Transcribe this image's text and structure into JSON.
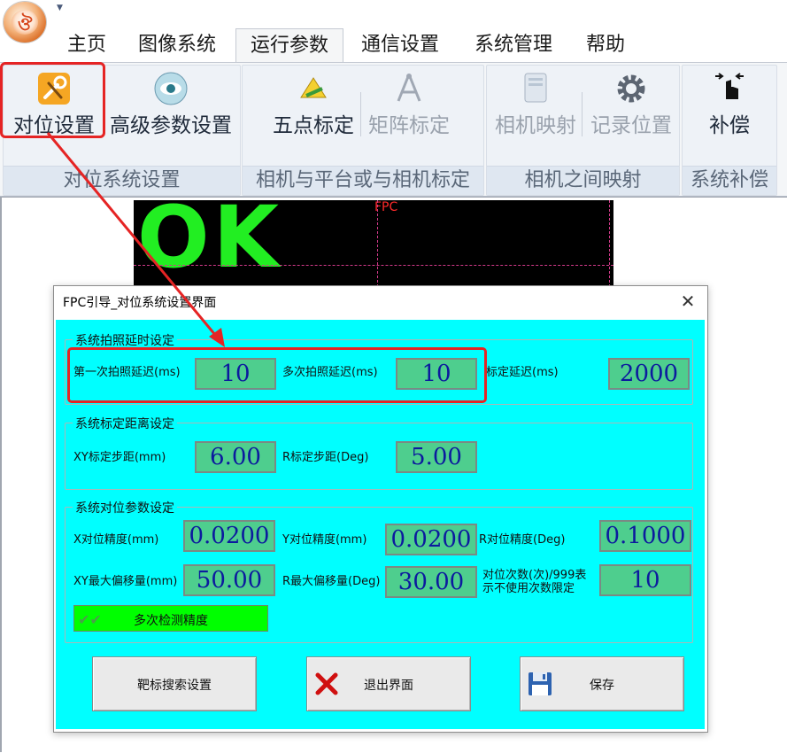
{
  "ribbon": {
    "tabs": [
      "主页",
      "图像系统",
      "运行参数",
      "通信设置",
      "系统管理",
      "帮助"
    ],
    "active_tab": "运行参数",
    "groups": [
      {
        "label": "对位系统设置",
        "buttons": [
          {
            "label": "对位设置",
            "icon": "wrench-screwdriver-icon"
          },
          {
            "label": "高级参数设置",
            "icon": "disc-icon"
          }
        ]
      },
      {
        "label": "相机与平台或与相机标定",
        "buttons": [
          {
            "label": "五点标定",
            "icon": "calibrate-icon"
          },
          {
            "label": "矩阵标定",
            "icon": "compass-icon"
          }
        ]
      },
      {
        "label": "相机之间映射",
        "buttons": [
          {
            "label": "相机映射",
            "icon": "map-icon"
          },
          {
            "label": "记录位置",
            "icon": "gear-icon"
          }
        ]
      },
      {
        "label": "系统补偿",
        "buttons": [
          {
            "label": "补偿",
            "icon": "hand-pointer-icon"
          }
        ]
      }
    ]
  },
  "video": {
    "status": "OK",
    "label": "FPC"
  },
  "dialog": {
    "title": "FPC引导_对位系统设置界面",
    "close": "✕",
    "group1": {
      "title": "系统拍照延时设定",
      "first_label": "第一次拍照延迟(ms)",
      "first_value": "10",
      "multi_label": "多次拍照延迟(ms)",
      "multi_value": "10",
      "calib_label": "标定延迟(ms)",
      "calib_value": "2000"
    },
    "group2": {
      "title": "系统标定距离设定",
      "xy_label": "XY标定步距(mm)",
      "xy_value": "6.00",
      "r_label": "R标定步距(Deg)",
      "r_value": "5.00"
    },
    "group3": {
      "title": "系统对位参数设定",
      "x_prec_label": "X对位精度(mm)",
      "x_prec_value": "0.0200",
      "y_prec_label": "Y对位精度(mm)",
      "y_prec_value": "0.0200",
      "r_prec_label": "R对位精度(Deg)",
      "r_prec_value": "0.1000",
      "xy_max_label": "XY最大偏移量(mm)",
      "xy_max_value": "50.00",
      "r_max_label": "R最大偏移量(Deg)",
      "r_max_value": "30.00",
      "count_label_1": "对位次数(次)/999表",
      "count_label_2": "示不使用次数限定",
      "count_value": "10",
      "multi_check_label": "多次检测精度",
      "multi_check_checked": true
    },
    "buttons": {
      "target_search": "靶标搜索设置",
      "exit": "退出界面",
      "save": "保存"
    }
  },
  "colors": {
    "dialog_bg": "#00ffff",
    "field_bg": "#4ece8e",
    "field_text": "#0c1a9e",
    "check_bg": "#00ff00",
    "highlight": "#e52424",
    "ok_text": "#22ee22"
  }
}
